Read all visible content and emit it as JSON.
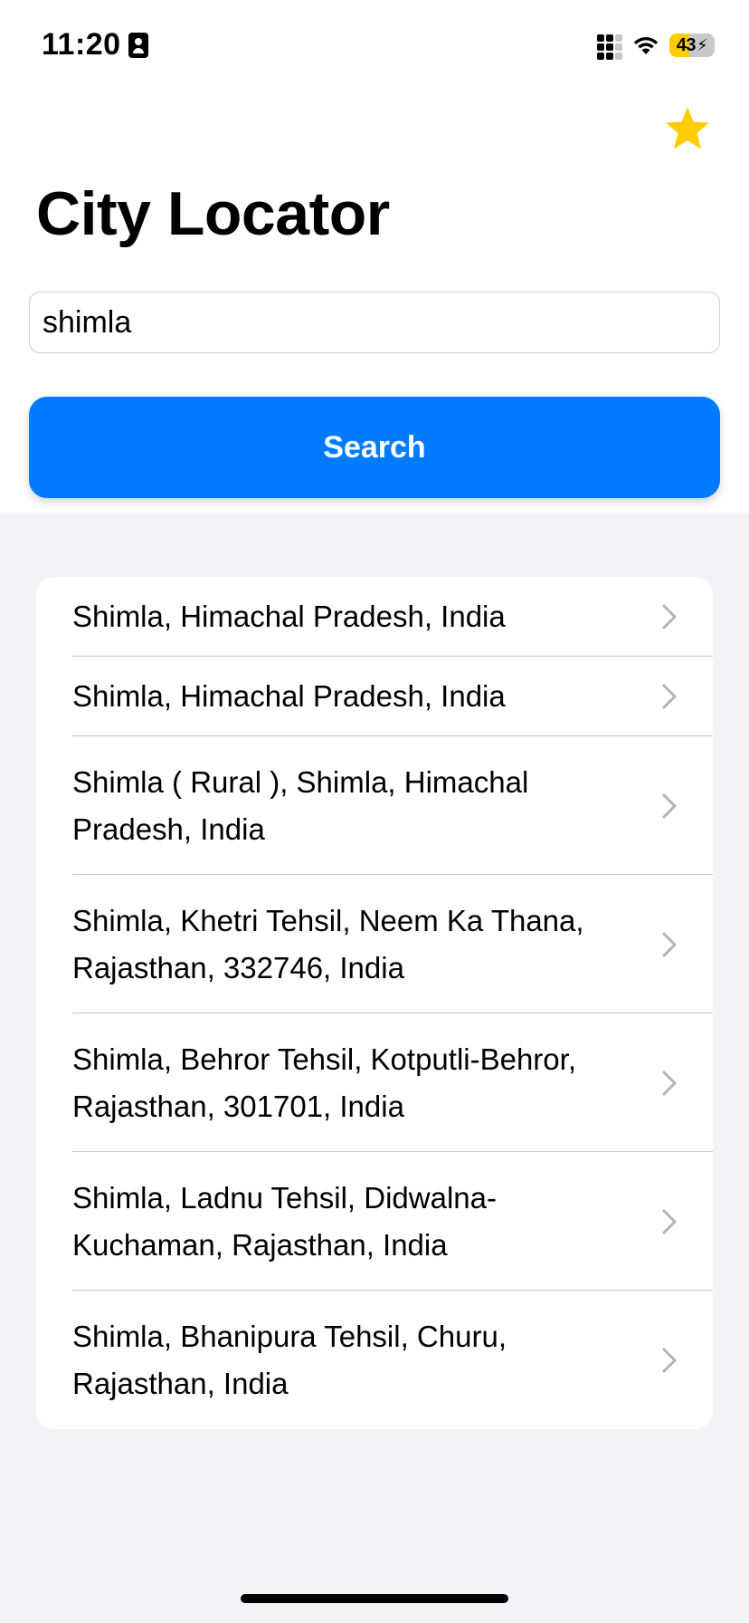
{
  "status_bar": {
    "time": "11:20",
    "battery": "43"
  },
  "header": {
    "title": "City Locator",
    "favorite_icon": "star-icon"
  },
  "search": {
    "value": "shimla",
    "button_label": "Search"
  },
  "results": [
    {
      "label": "Shimla, Himachal Pradesh, India"
    },
    {
      "label": "Shimla, Himachal Pradesh, India"
    },
    {
      "label": "Shimla ( Rural ), Shimla, Himachal Pradesh, India"
    },
    {
      "label": "Shimla, Khetri Tehsil, Neem Ka Thana, Rajasthan, 332746, India"
    },
    {
      "label": "Shimla, Behror Tehsil, Kotputli-Behror, Rajasthan, 301701, India"
    },
    {
      "label": "Shimla, Ladnu Tehsil, Didwalna-Kuchaman, Rajasthan, India"
    },
    {
      "label": "Shimla, Bhanipura Tehsil, Churu, Rajasthan, India"
    }
  ],
  "colors": {
    "accent": "#007aff",
    "star": "#ffcc00",
    "battery": "#ffcc00",
    "background": "#f2f2f7"
  }
}
